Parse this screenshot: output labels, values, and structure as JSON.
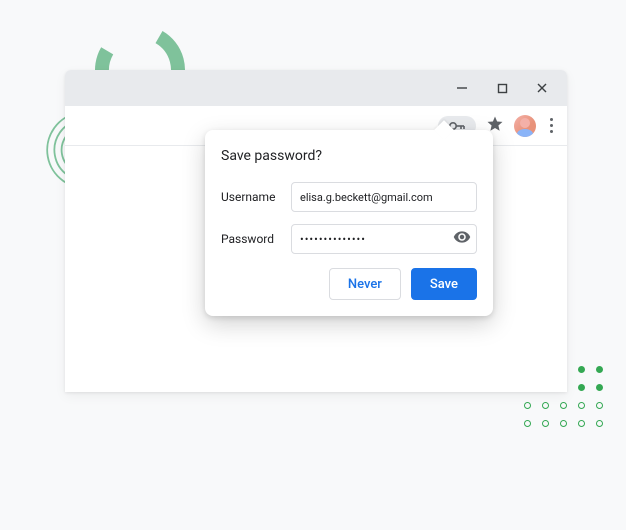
{
  "dialog": {
    "title": "Save password?",
    "username_label": "Username",
    "username_value": "elisa.g.beckett@gmail.com",
    "password_label": "Password",
    "password_mask": "••••••••••••••",
    "never_label": "Never",
    "save_label": "Save"
  },
  "colors": {
    "primary": "#1a73e8",
    "accent_green": "#34a853",
    "border": "#dadce0"
  }
}
